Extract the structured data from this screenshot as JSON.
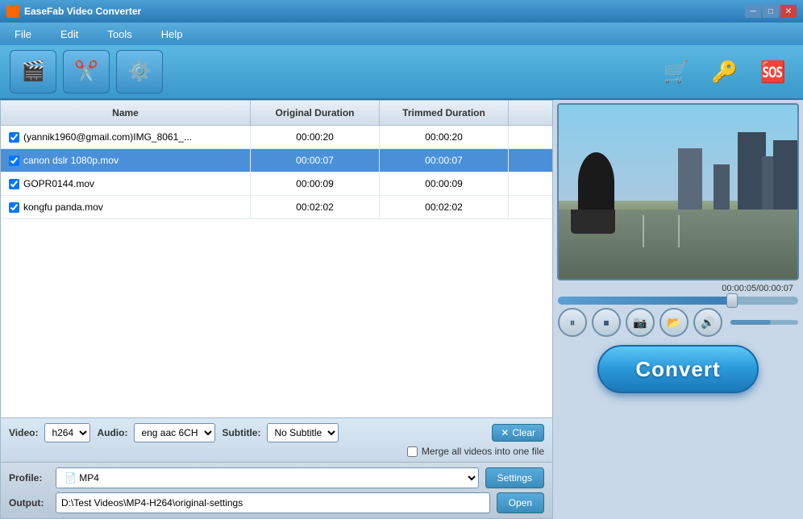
{
  "titleBar": {
    "title": "EaseFab Video Converter",
    "minimize": "─",
    "maximize": "□",
    "close": "✕"
  },
  "menu": {
    "items": [
      "File",
      "Edit",
      "Tools",
      "Help"
    ]
  },
  "toolbar": {
    "addVideo": "Add Video",
    "editVideo": "Edit Video",
    "settings": "Settings"
  },
  "fileList": {
    "headers": [
      "Name",
      "Original Duration",
      "Trimmed Duration"
    ],
    "rows": [
      {
        "name": "(yannik1960@gmail.com)IMG_8061_...",
        "originalDuration": "00:00:20",
        "trimmedDuration": "00:00:20",
        "selected": false,
        "checked": true
      },
      {
        "name": "canon dslr 1080p.mov",
        "originalDuration": "00:00:07",
        "trimmedDuration": "00:00:07",
        "selected": true,
        "checked": true
      },
      {
        "name": "GOPR0144.mov",
        "originalDuration": "00:00:09",
        "trimmedDuration": "00:00:09",
        "selected": false,
        "checked": true
      },
      {
        "name": "kongfu panda.mov",
        "originalDuration": "00:02:02",
        "trimmedDuration": "00:02:02",
        "selected": false,
        "checked": true
      }
    ]
  },
  "controls": {
    "videoLabel": "Video:",
    "videoValue": "h264",
    "audioLabel": "Audio:",
    "audioValue": "eng aac 6CH",
    "subtitleLabel": "Subtitle:",
    "subtitleValue": "No Subtitle",
    "clearLabel": "Clear",
    "mergeLabel": "Merge all videos into one file"
  },
  "profile": {
    "label": "Profile:",
    "value": "MP4",
    "settingsLabel": "Settings",
    "outputLabel": "Output:",
    "outputPath": "D:\\Test Videos\\MP4-H264\\original-settings",
    "openLabel": "Open"
  },
  "preview": {
    "timeDisplay": "00:00:05/00:00:07"
  },
  "convertBtn": "Convert"
}
